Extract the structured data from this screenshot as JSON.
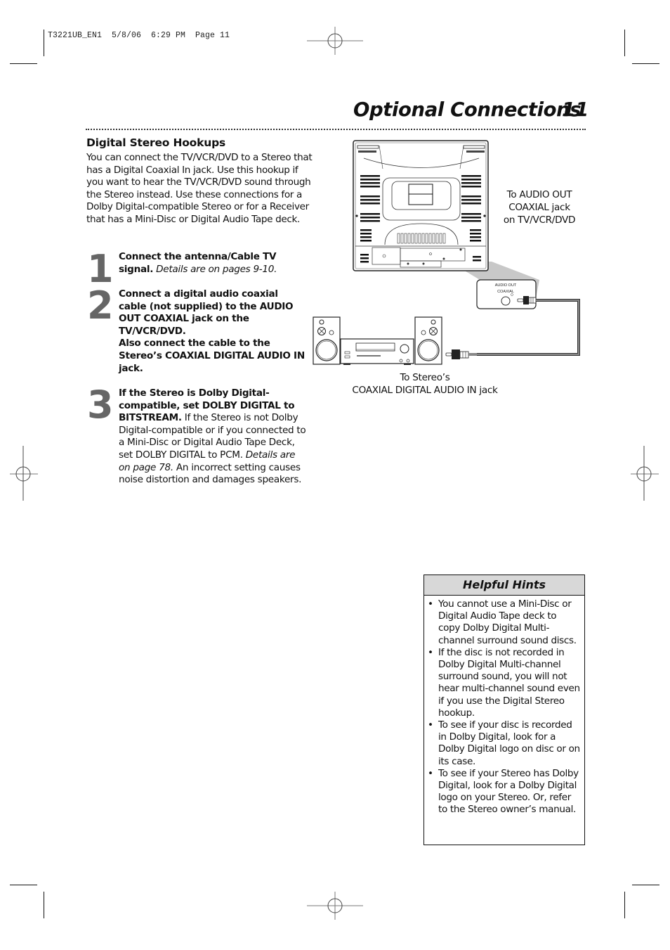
{
  "print_slug": "T3221UB_EN1  5/8/06  6:29 PM  Page 11",
  "header": {
    "title": "Optional Connections",
    "page_number": "11"
  },
  "section": {
    "heading": "Digital Stereo Hookups",
    "intro": "You can connect the TV/VCR/DVD to a Stereo that has a Digital Coaxial In jack. Use this hookup if you want to hear the TV/VCR/DVD sound through the Stereo instead. Use these connections for a Dolby Digital-compatible Stereo or for a Receiver that has a Mini-Disc or Digital Audio Tape deck."
  },
  "steps": [
    {
      "number": "1",
      "bold": "Connect the antenna/Cable TV signal.",
      "italic": "Details are on pages 9-10."
    },
    {
      "number": "2",
      "bold_a": "Connect a digital audio coaxial cable (not supplied) to the AUDIO OUT COAXIAL jack on the TV/VCR/DVD.",
      "bold_b": "Also connect the cable to the Stereo’s COAXIAL DIGITAL AUDIO IN jack."
    },
    {
      "number": "3",
      "bold": "If the Stereo is Dolby Digital-compatible, set DOLBY DIGITAL to BITSTREAM.",
      "text_a": "If the Stereo is not Dolby Digital-compatible or if you connected to a Mini-Disc or Digital Audio Tape Deck, set DOLBY DIGITAL to PCM.",
      "italic": "Details are on page 78.",
      "text_b": "An incorrect setting causes noise distortion and damages speakers."
    }
  ],
  "diagram": {
    "caption_tv_line1": "To AUDIO OUT",
    "caption_tv_line2": "COAXIAL jack",
    "caption_tv_line3": "on TV/VCR/DVD",
    "jack_label_line1": "AUDIO OUT",
    "jack_label_line2": "COAXIAL",
    "caption_stereo_line1": "To Stereo’s",
    "caption_stereo_line2": "COAXIAL DIGITAL AUDIO IN jack"
  },
  "hints": {
    "title": "Helpful Hints",
    "items": [
      "You cannot use a Mini-Disc or Digital Audio Tape deck to copy Dolby Digital Multi-channel surround sound discs.",
      "If the disc is not recorded in Dolby Digital Multi-channel surround sound, you will not hear multi-channel sound even if you use the Digital Stereo hookup.",
      "To see if your disc is recorded in Dolby Digital, look for a Dolby Digital logo on disc or on its case.",
      "To see if your Stereo has Dolby Digital, look for a Dolby Digital logo on your Stereo. Or, refer to the Stereo owner’s manual."
    ],
    "bullet": "•"
  },
  "colors": {
    "step_number": "#666666",
    "hints_header_bg": "#d8d8d8",
    "callout_fill": "#c8c8c8",
    "cable": "#555555"
  }
}
